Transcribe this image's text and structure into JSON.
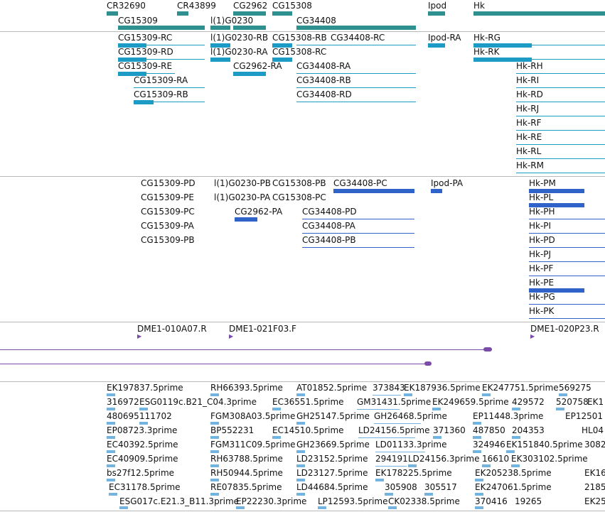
{
  "colors": {
    "gene": "#2e918f",
    "transcript": "#1c9cc4",
    "protein": "#2f63c9",
    "clone": "#7a4ca8",
    "est": "#73b3df",
    "divider": "#b9b9b9"
  },
  "genes": [
    "CR32690",
    "CR43899",
    "CG2962",
    "CG15308",
    "l(1)G0230",
    "CG15309",
    "CG34408",
    "Ipod",
    "Hk"
  ],
  "transcripts": [
    "CG15309-RC",
    "l(1)G0230-RB",
    "CG15308-RB",
    "CG34408-RC",
    "Ipod-RA",
    "Hk-RG",
    "CG15309-RD",
    "l(1)G0230-RA",
    "CG15308-RC",
    "Hk-RK",
    "CG15309-RE",
    "CG2962-RA",
    "CG34408-RA",
    "Hk-RH",
    "CG15309-RA",
    "CG34408-RB",
    "Hk-RI",
    "CG15309-RB",
    "CG34408-RD",
    "Hk-RD",
    "Hk-RJ",
    "Hk-RF",
    "Hk-RE",
    "Hk-RL",
    "Hk-RM"
  ],
  "proteins": [
    "CG15309-PD",
    "l(1)G0230-PB",
    "CG15308-PB",
    "CG34408-PC",
    "Ipod-PA",
    "Hk-PM",
    "CG15309-PE",
    "l(1)G0230-PA",
    "CG15308-PC",
    "Hk-PL",
    "CG15309-PC",
    "CG2962-PA",
    "CG34408-PD",
    "Hk-PH",
    "CG15309-PA",
    "CG34408-PA",
    "Hk-PI",
    "CG15309-PB",
    "CG34408-PB",
    "Hk-PD",
    "Hk-PJ",
    "Hk-PF",
    "Hk-PE",
    "Hk-PG",
    "Hk-PK"
  ],
  "clones": [
    "DME1-010A07.R",
    "DME1-021F03.F",
    "DME1-020P23.R"
  ],
  "ests": [
    "EK197837.5prime",
    "RH66393.5prime",
    "AT01852.5prime",
    "373843",
    "EK187936.5prime",
    "EK247751.5prime",
    "569275",
    "316972",
    "ESG0119c.B21_C04.3prime",
    "EC36551.5prime",
    "GM31431.5prime",
    "EK249659.5prime",
    "429572",
    "520758",
    "EK1",
    "480695",
    "111702",
    "FGM308A03.5prime",
    "GH25147.5prime",
    "GH26468.5prime",
    "EP11448.3prime",
    "EP12501",
    "EP08723.3prime",
    "BP552231",
    "EC14510.5prime",
    "LD24156.5prime",
    "371360",
    "487850",
    "204353",
    "HL04",
    "EC40392.5prime",
    "FGM311C09.5prime",
    "GH23669.5prime",
    "LD01133.3prime",
    "324946",
    "EK151840.5prime",
    "3082",
    "EC40909.5prime",
    "RH63788.5prime",
    "LD23152.5prime",
    "294191",
    "LD24156.3prime",
    "16610",
    "EK303102.5prime",
    "bs27f12.5prime",
    "RH50944.5prime",
    "LD23127.5prime",
    "EK178225.5prime",
    "EK205238.5prime",
    "EK16",
    "EC31178.5prime",
    "RE07835.5prime",
    "LD44684.5prime",
    "305908",
    "305517",
    "EK247061.5prime",
    "2185",
    "ESG017c.E21.3_B11.3prime",
    "EP22230.3prime",
    "LP12593.5prime",
    "CK02338.5prime",
    "370416",
    "19265",
    "EK25"
  ]
}
